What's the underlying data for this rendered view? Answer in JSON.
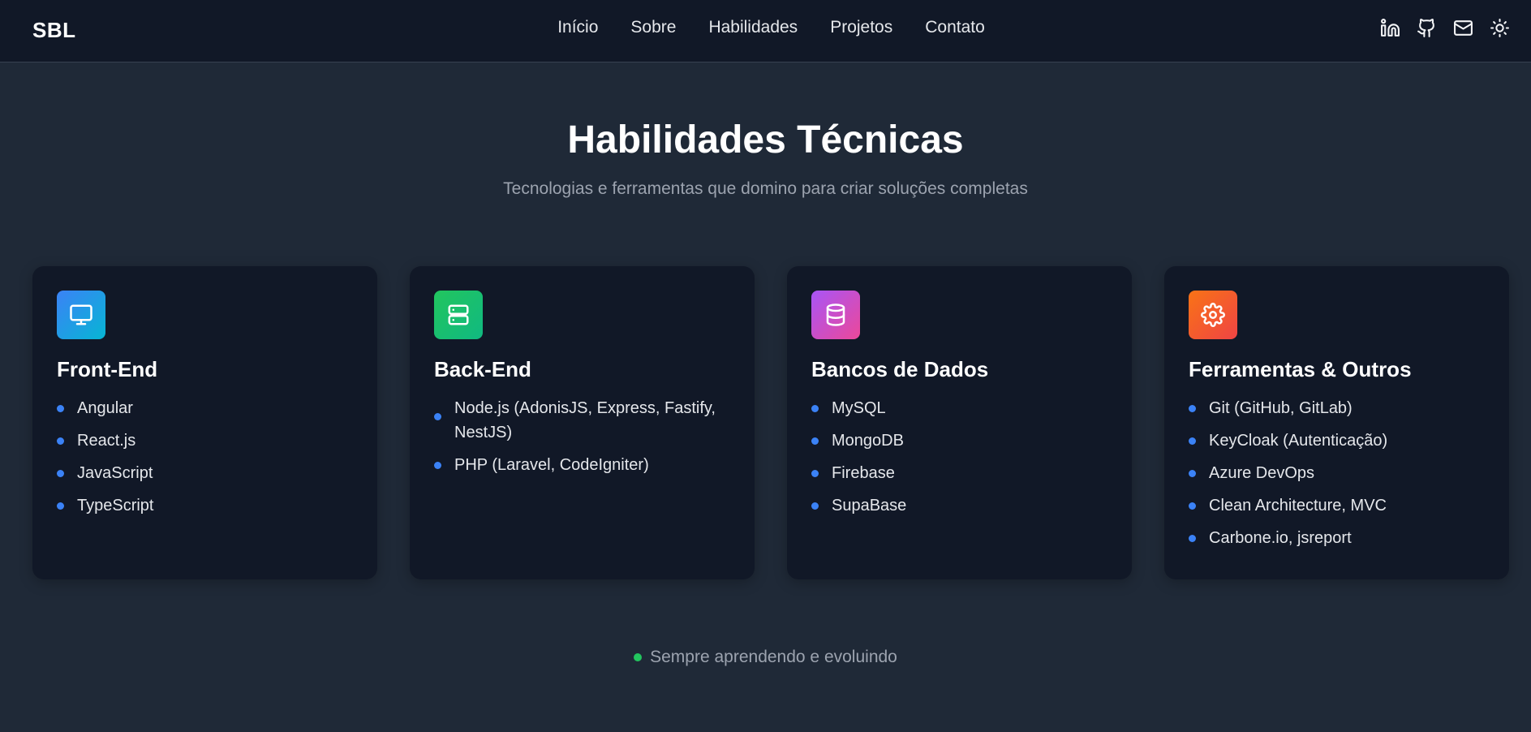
{
  "nav": {
    "logo": "SBL",
    "links": [
      "Início",
      "Sobre",
      "Habilidades",
      "Projetos",
      "Contato"
    ],
    "icons": [
      "linkedin-icon",
      "github-icon",
      "mail-icon",
      "sun-icon"
    ]
  },
  "section": {
    "title": "Habilidades Técnicas",
    "subtitle": "Tecnologias e ferramentas que domino para criar soluções completas"
  },
  "cards": [
    {
      "title": "Front-End",
      "icon": "monitor-icon",
      "color_from": "#3b82f6",
      "color_to": "#06b6d4",
      "items": [
        "Angular",
        "React.js",
        "JavaScript",
        "TypeScript"
      ]
    },
    {
      "title": "Back-End",
      "icon": "server-icon",
      "color_from": "#22c55e",
      "color_to": "#10b981",
      "items": [
        "Node.js (AdonisJS, Express, Fastify, NestJS)",
        "PHP (Laravel, CodeIgniter)"
      ]
    },
    {
      "title": "Bancos de Dados",
      "icon": "database-icon",
      "color_from": "#a855f7",
      "color_to": "#ec4899",
      "items": [
        "MySQL",
        "MongoDB",
        "Firebase",
        "SupaBase"
      ]
    },
    {
      "title": "Ferramentas & Outros",
      "icon": "settings-icon",
      "color_from": "#f97316",
      "color_to": "#ef4444",
      "items": [
        "Git (GitHub, GitLab)",
        "KeyCloak (Autenticação)",
        "Azure DevOps",
        "Clean Architecture, MVC",
        "Carbone.io, jsreport"
      ]
    }
  ],
  "footer": {
    "note": "Sempre aprendendo e evoluindo",
    "dot_color": "#22c55e"
  },
  "colors": {
    "background": "#1f2937",
    "navbar": "#111827",
    "card": "#111827",
    "bullet": "#3b82f6"
  }
}
